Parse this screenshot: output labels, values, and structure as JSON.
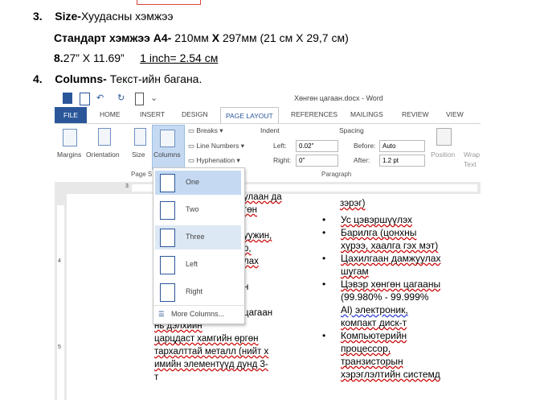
{
  "items": [
    {
      "number": "3.",
      "term": "Size-",
      "text": "Хуудасны хэмжээ"
    },
    {
      "number": "4.",
      "term": "Columns-",
      "text": " Текст-ийн багана."
    }
  ],
  "size": {
    "standard_label": "Стандарт хэмжээ А4-",
    "dim1": " 210мм ",
    "x": "X",
    "dim2": " 297мм (21 см X 29,7 см)",
    "inch_bold": "8.",
    "inch_rest": "27” X 11.69”",
    "conversion": "1 inch= 2.54 см"
  },
  "word": {
    "title": "Хөнгөн цагаан.docx - Word",
    "tabs": [
      "FILE",
      "HOME",
      "INSERT",
      "DESIGN",
      "PAGE LAYOUT",
      "REFERENCES",
      "MAILINGS",
      "REVIEW",
      "VIEW"
    ],
    "ribbon": {
      "margins": "Margins",
      "orientation": "Orientation",
      "size": "Size",
      "columns": "Columns",
      "breaks": "Breaks",
      "line_numbers": "Line Numbers",
      "hyphenation": "Hyphenation",
      "indent": "Indent",
      "left_label": "Left:",
      "left_value": "0.02\"",
      "right_label": "Right:",
      "right_value": "0\"",
      "spacing": "Spacing",
      "before_label": "Before:",
      "before_value": "Auto",
      "after_label": "After:",
      "after_value": "1.2 pt",
      "position": "Position",
      "wrap": "Wrap",
      "text": "Text",
      "page_setup_group": "Page S",
      "paragraph_group": "Paragraph"
    },
    "ruler": {
      "h3": "3",
      "v4": "4",
      "v5": "5"
    },
    "columns_menu": {
      "options": [
        "One",
        "Two",
        "Three",
        "Left",
        "Right"
      ],
      "more": "More Columns..."
    },
    "left_col_fragments": [
      "улаан да",
      "гөн",
      "уужин,",
      "р,",
      "лах",
      "н",
      "цагаан",
      "нь дэлхийн",
      "царцдаст хамгийн өргөн",
      "тархалттай металл (нийт х",
      "имийн элементүүд дунд 3-",
      "т"
    ],
    "right_col_top": "зэрэг)",
    "bullets": [
      [
        "Ус цэвэршүүлэх"
      ],
      [
        "Барилга (цонхны",
        "хүрээ, хаалга гэх мэт)"
      ],
      [
        "Цахилгаан дамжуулах",
        "шугам"
      ],
      [
        "Цэвэр хөнгөн цагааны",
        "(99.980% - 99.999%",
        "Al) электроник,",
        "компакт диск-т"
      ],
      [
        "Компьютерийн",
        "процессор,",
        "транзисторын",
        "хэрэглэлтийн системд"
      ]
    ]
  }
}
